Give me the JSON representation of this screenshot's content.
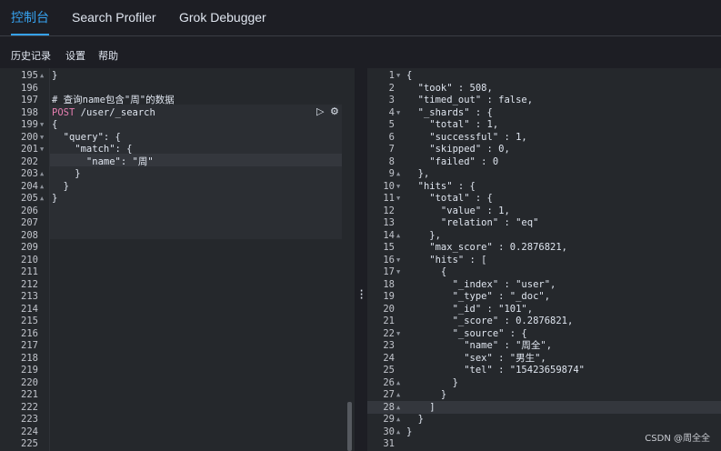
{
  "tabs": [
    {
      "label": "控制台",
      "active": true
    },
    {
      "label": "Search Profiler",
      "active": false
    },
    {
      "label": "Grok Debugger",
      "active": false
    }
  ],
  "menu": [
    "历史记录",
    "设置",
    "帮助"
  ],
  "left_lines": [
    {
      "n": "195",
      "fold": "▲",
      "text": "}"
    },
    {
      "n": "196",
      "fold": "",
      "text": ""
    },
    {
      "n": "197",
      "fold": "",
      "text": "# 查询name包含\"周\"的数据"
    },
    {
      "n": "198",
      "fold": "",
      "text": "POST /user/_search"
    },
    {
      "n": "199",
      "fold": "▼",
      "text": "{"
    },
    {
      "n": "200",
      "fold": "▼",
      "text": "  \"query\": {"
    },
    {
      "n": "201",
      "fold": "▼",
      "text": "    \"match\": {"
    },
    {
      "n": "202",
      "fold": "",
      "text": "      \"name\": \"周\""
    },
    {
      "n": "203",
      "fold": "▲",
      "text": "    }"
    },
    {
      "n": "204",
      "fold": "▲",
      "text": "  }"
    },
    {
      "n": "205",
      "fold": "▲",
      "text": "}"
    },
    {
      "n": "206",
      "fold": "",
      "text": ""
    },
    {
      "n": "207",
      "fold": "",
      "text": ""
    },
    {
      "n": "208",
      "fold": "",
      "text": ""
    },
    {
      "n": "209",
      "fold": "",
      "text": ""
    },
    {
      "n": "210",
      "fold": "",
      "text": ""
    },
    {
      "n": "211",
      "fold": "",
      "text": ""
    },
    {
      "n": "212",
      "fold": "",
      "text": ""
    },
    {
      "n": "213",
      "fold": "",
      "text": ""
    },
    {
      "n": "214",
      "fold": "",
      "text": ""
    },
    {
      "n": "215",
      "fold": "",
      "text": ""
    },
    {
      "n": "216",
      "fold": "",
      "text": ""
    },
    {
      "n": "217",
      "fold": "",
      "text": ""
    },
    {
      "n": "218",
      "fold": "",
      "text": ""
    },
    {
      "n": "219",
      "fold": "",
      "text": ""
    },
    {
      "n": "220",
      "fold": "",
      "text": ""
    },
    {
      "n": "221",
      "fold": "",
      "text": ""
    },
    {
      "n": "222",
      "fold": "",
      "text": ""
    },
    {
      "n": "223",
      "fold": "",
      "text": ""
    },
    {
      "n": "224",
      "fold": "",
      "text": ""
    },
    {
      "n": "225",
      "fold": "",
      "text": ""
    }
  ],
  "right_lines": [
    {
      "n": "1",
      "fold": "▼",
      "text": "{"
    },
    {
      "n": "2",
      "fold": "",
      "text": "  \"took\" : 508,"
    },
    {
      "n": "3",
      "fold": "",
      "text": "  \"timed_out\" : false,"
    },
    {
      "n": "4",
      "fold": "▼",
      "text": "  \"_shards\" : {"
    },
    {
      "n": "5",
      "fold": "",
      "text": "    \"total\" : 1,"
    },
    {
      "n": "6",
      "fold": "",
      "text": "    \"successful\" : 1,"
    },
    {
      "n": "7",
      "fold": "",
      "text": "    \"skipped\" : 0,"
    },
    {
      "n": "8",
      "fold": "",
      "text": "    \"failed\" : 0"
    },
    {
      "n": "9",
      "fold": "▲",
      "text": "  },"
    },
    {
      "n": "10",
      "fold": "▼",
      "text": "  \"hits\" : {"
    },
    {
      "n": "11",
      "fold": "▼",
      "text": "    \"total\" : {"
    },
    {
      "n": "12",
      "fold": "",
      "text": "      \"value\" : 1,"
    },
    {
      "n": "13",
      "fold": "",
      "text": "      \"relation\" : \"eq\""
    },
    {
      "n": "14",
      "fold": "▲",
      "text": "    },"
    },
    {
      "n": "15",
      "fold": "",
      "text": "    \"max_score\" : 0.2876821,"
    },
    {
      "n": "16",
      "fold": "▼",
      "text": "    \"hits\" : ["
    },
    {
      "n": "17",
      "fold": "▼",
      "text": "      {"
    },
    {
      "n": "18",
      "fold": "",
      "text": "        \"_index\" : \"user\","
    },
    {
      "n": "19",
      "fold": "",
      "text": "        \"_type\" : \"_doc\","
    },
    {
      "n": "20",
      "fold": "",
      "text": "        \"_id\" : \"101\","
    },
    {
      "n": "21",
      "fold": "",
      "text": "        \"_score\" : 0.2876821,"
    },
    {
      "n": "22",
      "fold": "▼",
      "text": "        \"_source\" : {"
    },
    {
      "n": "23",
      "fold": "",
      "text": "          \"name\" : \"周全\","
    },
    {
      "n": "24",
      "fold": "",
      "text": "          \"sex\" : \"男生\","
    },
    {
      "n": "25",
      "fold": "",
      "text": "          \"tel\" : \"15423659874\""
    },
    {
      "n": "26",
      "fold": "▲",
      "text": "        }"
    },
    {
      "n": "27",
      "fold": "▲",
      "text": "      }"
    },
    {
      "n": "28",
      "fold": "▲",
      "text": "    ]"
    },
    {
      "n": "29",
      "fold": "▲",
      "text": "  }"
    },
    {
      "n": "30",
      "fold": "▲",
      "text": "}"
    },
    {
      "n": "31",
      "fold": "",
      "text": ""
    }
  ],
  "watermark": "CSDN @周全全",
  "colors": {
    "accent": "#36a2ef",
    "keyword": "#e57eb0",
    "background": "#25282c",
    "toolbar": "#1d1e24"
  }
}
